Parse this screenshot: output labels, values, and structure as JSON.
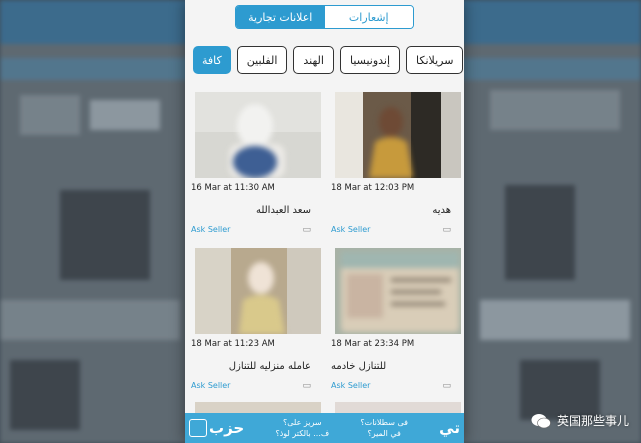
{
  "tabs": [
    {
      "label": "إشعارات",
      "active": false
    },
    {
      "label": "اعلانات تجارية",
      "active": true
    }
  ],
  "categories": [
    {
      "label": "كافة",
      "active": true
    },
    {
      "label": "الفلبين",
      "active": false
    },
    {
      "label": "الهند",
      "active": false
    },
    {
      "label": "إندونيسيا",
      "active": false
    },
    {
      "label": "سريلانكا",
      "active": false
    }
  ],
  "listings": [
    {
      "time": "18 Mar at 12:03 PM",
      "name": "هديه",
      "ask": "Ask Seller"
    },
    {
      "time": "16 Mar at 11:30 AM",
      "name": "سعد العبدالله",
      "ask": "Ask Seller"
    },
    {
      "time": "18 Mar at 23:34 PM",
      "name": "للتنازل خادمه",
      "ask": "Ask Seller"
    },
    {
      "time": "18 Mar at 11:23 AM",
      "name": "عامله منزليه للتنازل",
      "ask": "Ask Seller"
    }
  ],
  "banner": {
    "logo_left": "حزب",
    "line1": "سريز علی؟",
    "line2": "ف... بالکتر لوذ؟",
    "line3": "فی سطلانات؟",
    "line4": "في المیر؟",
    "logo_right": "تي"
  },
  "watermark": {
    "text": "英国那些事儿"
  },
  "colors": {
    "accent": "#2d9bd0",
    "banner": "#3fa8d7"
  }
}
